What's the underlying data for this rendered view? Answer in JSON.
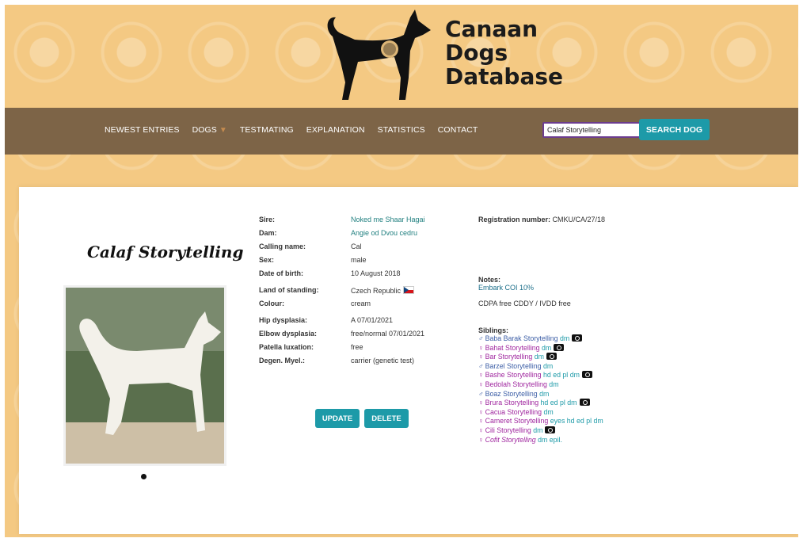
{
  "brand": {
    "line1": "Canaan",
    "line2": "Dogs",
    "line3": "Database"
  },
  "nav": {
    "items": [
      "NEWEST ENTRIES",
      "DOGS",
      "TESTMATING",
      "EXPLANATION",
      "STATISTICS",
      "CONTACT"
    ]
  },
  "search": {
    "value": "Calaf Storytelling",
    "button_label": "SEARCH DOG"
  },
  "dog": {
    "name": "Calaf Storytelling",
    "fields": [
      {
        "label": "Sire:",
        "value": "Noked me Shaar Hagai"
      },
      {
        "label": "Dam:",
        "value": "Angie od Dvou cedru"
      },
      {
        "label": "Calling name:",
        "value": "Cal"
      },
      {
        "label": "Sex:",
        "value": "male"
      },
      {
        "label": "Date of birth:",
        "value": "10 August 2018"
      },
      {
        "label": "Land of standing:",
        "value": "Czech Republic"
      },
      {
        "label": "Colour:",
        "value": "cream"
      },
      {
        "label": "Hip dysplasia:",
        "value": "A  07/01/2021"
      },
      {
        "label": "Elbow dysplasia:",
        "value": "free/normal 07/01/2021"
      },
      {
        "label": "Patella luxation:",
        "value": "free"
      },
      {
        "label": "Degen. Myel.:",
        "value": "carrier (genetic test)"
      }
    ],
    "flag_icon": "czech-flag-icon"
  },
  "actions": {
    "update_label": "UPDATE",
    "delete_label": "DELETE"
  },
  "registration": {
    "label": "Registration number:",
    "value": "CMKU/CA/27/18"
  },
  "notes": {
    "label": "Notes:",
    "line1": "Embark COI 10%",
    "line2": "CDPA free CDDY / IVDD free"
  },
  "siblings": {
    "label": "Siblings:",
    "items": [
      {
        "sym": "♂",
        "name": "Baba Barak Storytelling",
        "tags": " dm",
        "cam": true
      },
      {
        "sym": "♀",
        "name": "Bahat Storytelling",
        "tags": " dm",
        "cam": true
      },
      {
        "sym": "♀",
        "name": "Bar Storytelling",
        "tags": " dm",
        "cam": true
      },
      {
        "sym": "♂",
        "name": "Barzel Storytelling",
        "tags": " dm",
        "cam": false
      },
      {
        "sym": "♀",
        "name": "Bashe Storytelling",
        "tags": " hd ed pl dm",
        "cam": true
      },
      {
        "sym": "♀",
        "name": "Bedolah Storytelling",
        "tags": " dm",
        "cam": false
      },
      {
        "sym": "♂",
        "name": "Boaz Storytelling",
        "tags": " dm",
        "cam": false
      },
      {
        "sym": "♀",
        "name": "Brura Storytelling",
        "tags": " hd ed pl dm",
        "cam": true
      },
      {
        "sym": "♀",
        "name": "Cacua Storytelling",
        "tags": " dm",
        "cam": false
      },
      {
        "sym": "♀",
        "name": "Cameret Storytelling",
        "tags": " eyes hd ed pl dm",
        "cam": false
      },
      {
        "sym": "♀",
        "name": "Cili Storytelling",
        "tags": " dm",
        "cam": true
      },
      {
        "sym": "♀",
        "name": "Cofit Storytelling",
        "tags": " dm epil.",
        "cam": false
      }
    ]
  }
}
